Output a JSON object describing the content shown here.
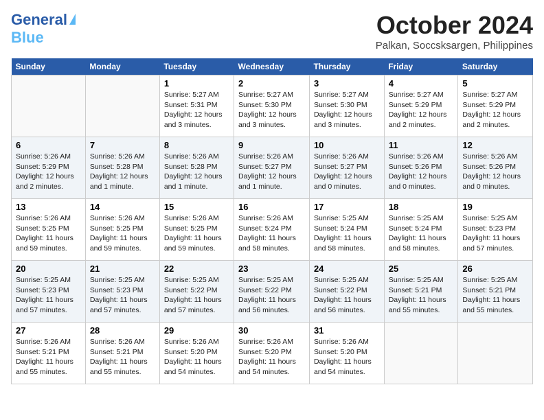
{
  "logo": {
    "line1": "General",
    "line2": "Blue",
    "tagline": ""
  },
  "header": {
    "month": "October 2024",
    "location": "Palkan, Soccsksargen, Philippines"
  },
  "weekdays": [
    "Sunday",
    "Monday",
    "Tuesday",
    "Wednesday",
    "Thursday",
    "Friday",
    "Saturday"
  ],
  "weeks": [
    [
      {
        "day": "",
        "info": ""
      },
      {
        "day": "",
        "info": ""
      },
      {
        "day": "1",
        "info": "Sunrise: 5:27 AM\nSunset: 5:31 PM\nDaylight: 12 hours and 3 minutes."
      },
      {
        "day": "2",
        "info": "Sunrise: 5:27 AM\nSunset: 5:30 PM\nDaylight: 12 hours and 3 minutes."
      },
      {
        "day": "3",
        "info": "Sunrise: 5:27 AM\nSunset: 5:30 PM\nDaylight: 12 hours and 3 minutes."
      },
      {
        "day": "4",
        "info": "Sunrise: 5:27 AM\nSunset: 5:29 PM\nDaylight: 12 hours and 2 minutes."
      },
      {
        "day": "5",
        "info": "Sunrise: 5:27 AM\nSunset: 5:29 PM\nDaylight: 12 hours and 2 minutes."
      }
    ],
    [
      {
        "day": "6",
        "info": "Sunrise: 5:26 AM\nSunset: 5:29 PM\nDaylight: 12 hours and 2 minutes."
      },
      {
        "day": "7",
        "info": "Sunrise: 5:26 AM\nSunset: 5:28 PM\nDaylight: 12 hours and 1 minute."
      },
      {
        "day": "8",
        "info": "Sunrise: 5:26 AM\nSunset: 5:28 PM\nDaylight: 12 hours and 1 minute."
      },
      {
        "day": "9",
        "info": "Sunrise: 5:26 AM\nSunset: 5:27 PM\nDaylight: 12 hours and 1 minute."
      },
      {
        "day": "10",
        "info": "Sunrise: 5:26 AM\nSunset: 5:27 PM\nDaylight: 12 hours and 0 minutes."
      },
      {
        "day": "11",
        "info": "Sunrise: 5:26 AM\nSunset: 5:26 PM\nDaylight: 12 hours and 0 minutes."
      },
      {
        "day": "12",
        "info": "Sunrise: 5:26 AM\nSunset: 5:26 PM\nDaylight: 12 hours and 0 minutes."
      }
    ],
    [
      {
        "day": "13",
        "info": "Sunrise: 5:26 AM\nSunset: 5:25 PM\nDaylight: 11 hours and 59 minutes."
      },
      {
        "day": "14",
        "info": "Sunrise: 5:26 AM\nSunset: 5:25 PM\nDaylight: 11 hours and 59 minutes."
      },
      {
        "day": "15",
        "info": "Sunrise: 5:26 AM\nSunset: 5:25 PM\nDaylight: 11 hours and 59 minutes."
      },
      {
        "day": "16",
        "info": "Sunrise: 5:26 AM\nSunset: 5:24 PM\nDaylight: 11 hours and 58 minutes."
      },
      {
        "day": "17",
        "info": "Sunrise: 5:25 AM\nSunset: 5:24 PM\nDaylight: 11 hours and 58 minutes."
      },
      {
        "day": "18",
        "info": "Sunrise: 5:25 AM\nSunset: 5:24 PM\nDaylight: 11 hours and 58 minutes."
      },
      {
        "day": "19",
        "info": "Sunrise: 5:25 AM\nSunset: 5:23 PM\nDaylight: 11 hours and 57 minutes."
      }
    ],
    [
      {
        "day": "20",
        "info": "Sunrise: 5:25 AM\nSunset: 5:23 PM\nDaylight: 11 hours and 57 minutes."
      },
      {
        "day": "21",
        "info": "Sunrise: 5:25 AM\nSunset: 5:23 PM\nDaylight: 11 hours and 57 minutes."
      },
      {
        "day": "22",
        "info": "Sunrise: 5:25 AM\nSunset: 5:22 PM\nDaylight: 11 hours and 57 minutes."
      },
      {
        "day": "23",
        "info": "Sunrise: 5:25 AM\nSunset: 5:22 PM\nDaylight: 11 hours and 56 minutes."
      },
      {
        "day": "24",
        "info": "Sunrise: 5:25 AM\nSunset: 5:22 PM\nDaylight: 11 hours and 56 minutes."
      },
      {
        "day": "25",
        "info": "Sunrise: 5:25 AM\nSunset: 5:21 PM\nDaylight: 11 hours and 55 minutes."
      },
      {
        "day": "26",
        "info": "Sunrise: 5:25 AM\nSunset: 5:21 PM\nDaylight: 11 hours and 55 minutes."
      }
    ],
    [
      {
        "day": "27",
        "info": "Sunrise: 5:26 AM\nSunset: 5:21 PM\nDaylight: 11 hours and 55 minutes."
      },
      {
        "day": "28",
        "info": "Sunrise: 5:26 AM\nSunset: 5:21 PM\nDaylight: 11 hours and 55 minutes."
      },
      {
        "day": "29",
        "info": "Sunrise: 5:26 AM\nSunset: 5:20 PM\nDaylight: 11 hours and 54 minutes."
      },
      {
        "day": "30",
        "info": "Sunrise: 5:26 AM\nSunset: 5:20 PM\nDaylight: 11 hours and 54 minutes."
      },
      {
        "day": "31",
        "info": "Sunrise: 5:26 AM\nSunset: 5:20 PM\nDaylight: 11 hours and 54 minutes."
      },
      {
        "day": "",
        "info": ""
      },
      {
        "day": "",
        "info": ""
      }
    ]
  ]
}
